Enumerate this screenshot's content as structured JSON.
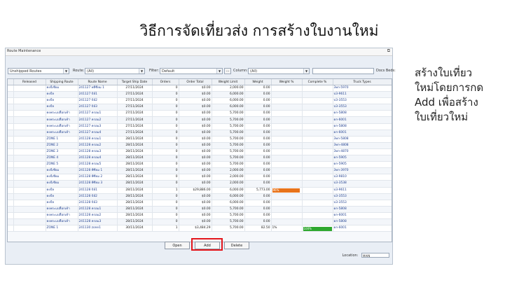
{
  "slide_title": "วิธีการจัดเที่ยวส่ง การสร้างใบงานใหม่",
  "note_lines": [
    "สร้างใบเที่ยว",
    "ใหม่โดยการกด",
    "Add เพื่อสร้าง",
    "ใบเที่ยวใหม่"
  ],
  "window": {
    "title": "Route Maintenance",
    "restore_glyph": "⧉"
  },
  "filters": {
    "view_value": "Unshipped Routes",
    "route_label": "Route:",
    "route_value": "(All)",
    "filter_label": "Filter:",
    "filter_value": "Default",
    "ellipsis": "...",
    "column_label": "Column:",
    "column_value": "(All)",
    "search_value": "",
    "search_label": "Docs Beds:"
  },
  "table": {
    "columns": [
      "",
      "Released",
      "Shipping Route",
      "Route Name",
      "Target Ship Date",
      "Orders",
      "Order Total",
      "Weight Limit",
      "Weight",
      "Weight %",
      "Complete %",
      "Truck Types"
    ],
    "rows": [
      [
        "",
        "",
        "คงบิ้เซียม",
        "241127 พลีซียม 1",
        "27/11/2024",
        "0",
        "$0.00",
        "2,000.00",
        "0.00",
        "",
        "",
        "3ทก-5970"
      ],
      [
        "",
        "",
        "คงบิ้ล",
        "241127 บิล์1",
        "27/11/2024",
        "0",
        "$0.00",
        "6,000.00",
        "0.00",
        "",
        "",
        "ป3-9611"
      ],
      [
        "",
        "",
        "คงบิ้ล",
        "241127 บิล์2",
        "27/11/2024",
        "0",
        "$0.00",
        "6,000.00",
        "0.00",
        "",
        "",
        "ป3-3553"
      ],
      [
        "",
        "",
        "คงบิ้ล",
        "241127 บิล์3",
        "27/11/2024",
        "0",
        "$0.00",
        "6,000.00",
        "0.00",
        "",
        "",
        "ป3-3553"
      ],
      [
        "",
        "",
        "คงพระแปลือกเท้า",
        "241127 ครอม1",
        "27/11/2024",
        "0",
        "$0.00",
        "5,700.00",
        "0.00",
        "",
        "",
        "ดก-5808"
      ],
      [
        "",
        "",
        "คงพระแปลือกเท้า",
        "241127 ครอม2",
        "27/11/2024",
        "0",
        "$0.00",
        "5,700.00",
        "0.00",
        "",
        "",
        "ดก-6001"
      ],
      [
        "",
        "",
        "คงพระแปลือกเท้า",
        "241127 ครอม3",
        "27/11/2024",
        "0",
        "$0.00",
        "5,700.00",
        "0.00",
        "",
        "",
        "ดก-5808"
      ],
      [
        "",
        "",
        "คงพระแปลือกเท้า",
        "241127 ครอม4",
        "27/11/2024",
        "0",
        "$0.00",
        "5,700.00",
        "0.00",
        "",
        "",
        "ดก-6001"
      ],
      [
        "",
        "",
        "ZONE 1",
        "241128 ครอม1",
        "28/11/2024",
        "0",
        "$0.00",
        "5,700.00",
        "0.00",
        "",
        "",
        "3ทก-5808"
      ],
      [
        "",
        "",
        "ZONE 2",
        "241128 ครอม2",
        "28/11/2024",
        "0",
        "$0.00",
        "5,700.00",
        "0.00",
        "",
        "",
        "3ทก-4808"
      ],
      [
        "",
        "",
        "ZONE 3",
        "241128 ครอม3",
        "28/11/2024",
        "0",
        "$0.00",
        "5,700.00",
        "0.00",
        "",
        "",
        "3ทก-4870"
      ],
      [
        "",
        "",
        "ZONE 4",
        "241128 ครอม4",
        "28/11/2024",
        "0",
        "$0.00",
        "5,700.00",
        "0.00",
        "",
        "",
        "ดก-5905"
      ],
      [
        "",
        "",
        "ZONE 5",
        "241128 ครอม5",
        "28/11/2024",
        "0",
        "$0.00",
        "5,700.00",
        "0.00",
        "",
        "",
        "ดก-5905"
      ],
      [
        "",
        "",
        "คงบิ้เซียม",
        "241128 พีซียม 1",
        "28/11/2024",
        "0",
        "$0.00",
        "2,000.00",
        "0.00",
        "",
        "",
        "3ทก-3970"
      ],
      [
        "",
        "",
        "คงบิ้เซียม",
        "241128 พีซียม 2",
        "28/11/2024",
        "0",
        "$0.00",
        "2,000.00",
        "0.00",
        "",
        "",
        "ป3-9810"
      ],
      [
        "",
        "",
        "คงบิ้เซียม",
        "241128 พีซียม 3",
        "28/11/2024",
        "0",
        "$0.00",
        "2,000.00",
        "0.00",
        "",
        "",
        "ป3-3538"
      ],
      [
        "",
        "",
        "คงบิ้ล",
        "241128 บิล์1",
        "28/11/2024",
        "1",
        "$29,886.00",
        "6,000.00",
        "5,773.00",
        "96%",
        "",
        "ป3-9611"
      ],
      [
        "",
        "",
        "คงบิ้ล",
        "241128 บิล์2",
        "28/11/2024",
        "0",
        "$0.00",
        "6,000.00",
        "0.00",
        "",
        "",
        "ป3-3553"
      ],
      [
        "",
        "",
        "คงบิ้ล",
        "241128 บิล์3",
        "28/11/2024",
        "0",
        "$0.00",
        "6,000.00",
        "0.00",
        "",
        "",
        "ป3-3553"
      ],
      [
        "",
        "",
        "คงพระแปลือกเท้า",
        "241128 ครอม1",
        "28/11/2024",
        "0",
        "$0.00",
        "5,700.00",
        "0.00",
        "",
        "",
        "ดก-5808"
      ],
      [
        "",
        "",
        "คงพระแปลือกเท้า",
        "241128 ครอม2",
        "28/11/2024",
        "0",
        "$0.00",
        "5,700.00",
        "0.00",
        "",
        "",
        "ดก-6001"
      ],
      [
        "",
        "",
        "คงพระแปลือกเท้า",
        "241128 ครอม3",
        "28/11/2024",
        "0",
        "$0.00",
        "5,700.00",
        "0.00",
        "",
        "",
        "ดก-5808"
      ],
      [
        "",
        "",
        "ZONE 1",
        "241130 zone1",
        "30/11/2024",
        "1",
        "$3,484.29",
        "5,700.00",
        "82.50",
        "1%",
        "100%",
        "ดก-6001"
      ]
    ],
    "weight_bar": {
      "row": 16,
      "percent": 96,
      "color": "#e8731a"
    },
    "complete_bar": {
      "row": 22,
      "percent": 100,
      "color": "#2fa82f"
    }
  },
  "buttons": {
    "open": "Open",
    "add": "Add",
    "delete": "Delete"
  },
  "status": {
    "location_label": "Location:",
    "location_value": "MAIN"
  },
  "colors": {
    "highlight": "#e3161c",
    "weight_bar": "#e8731a",
    "complete_bar": "#2fa82f"
  }
}
